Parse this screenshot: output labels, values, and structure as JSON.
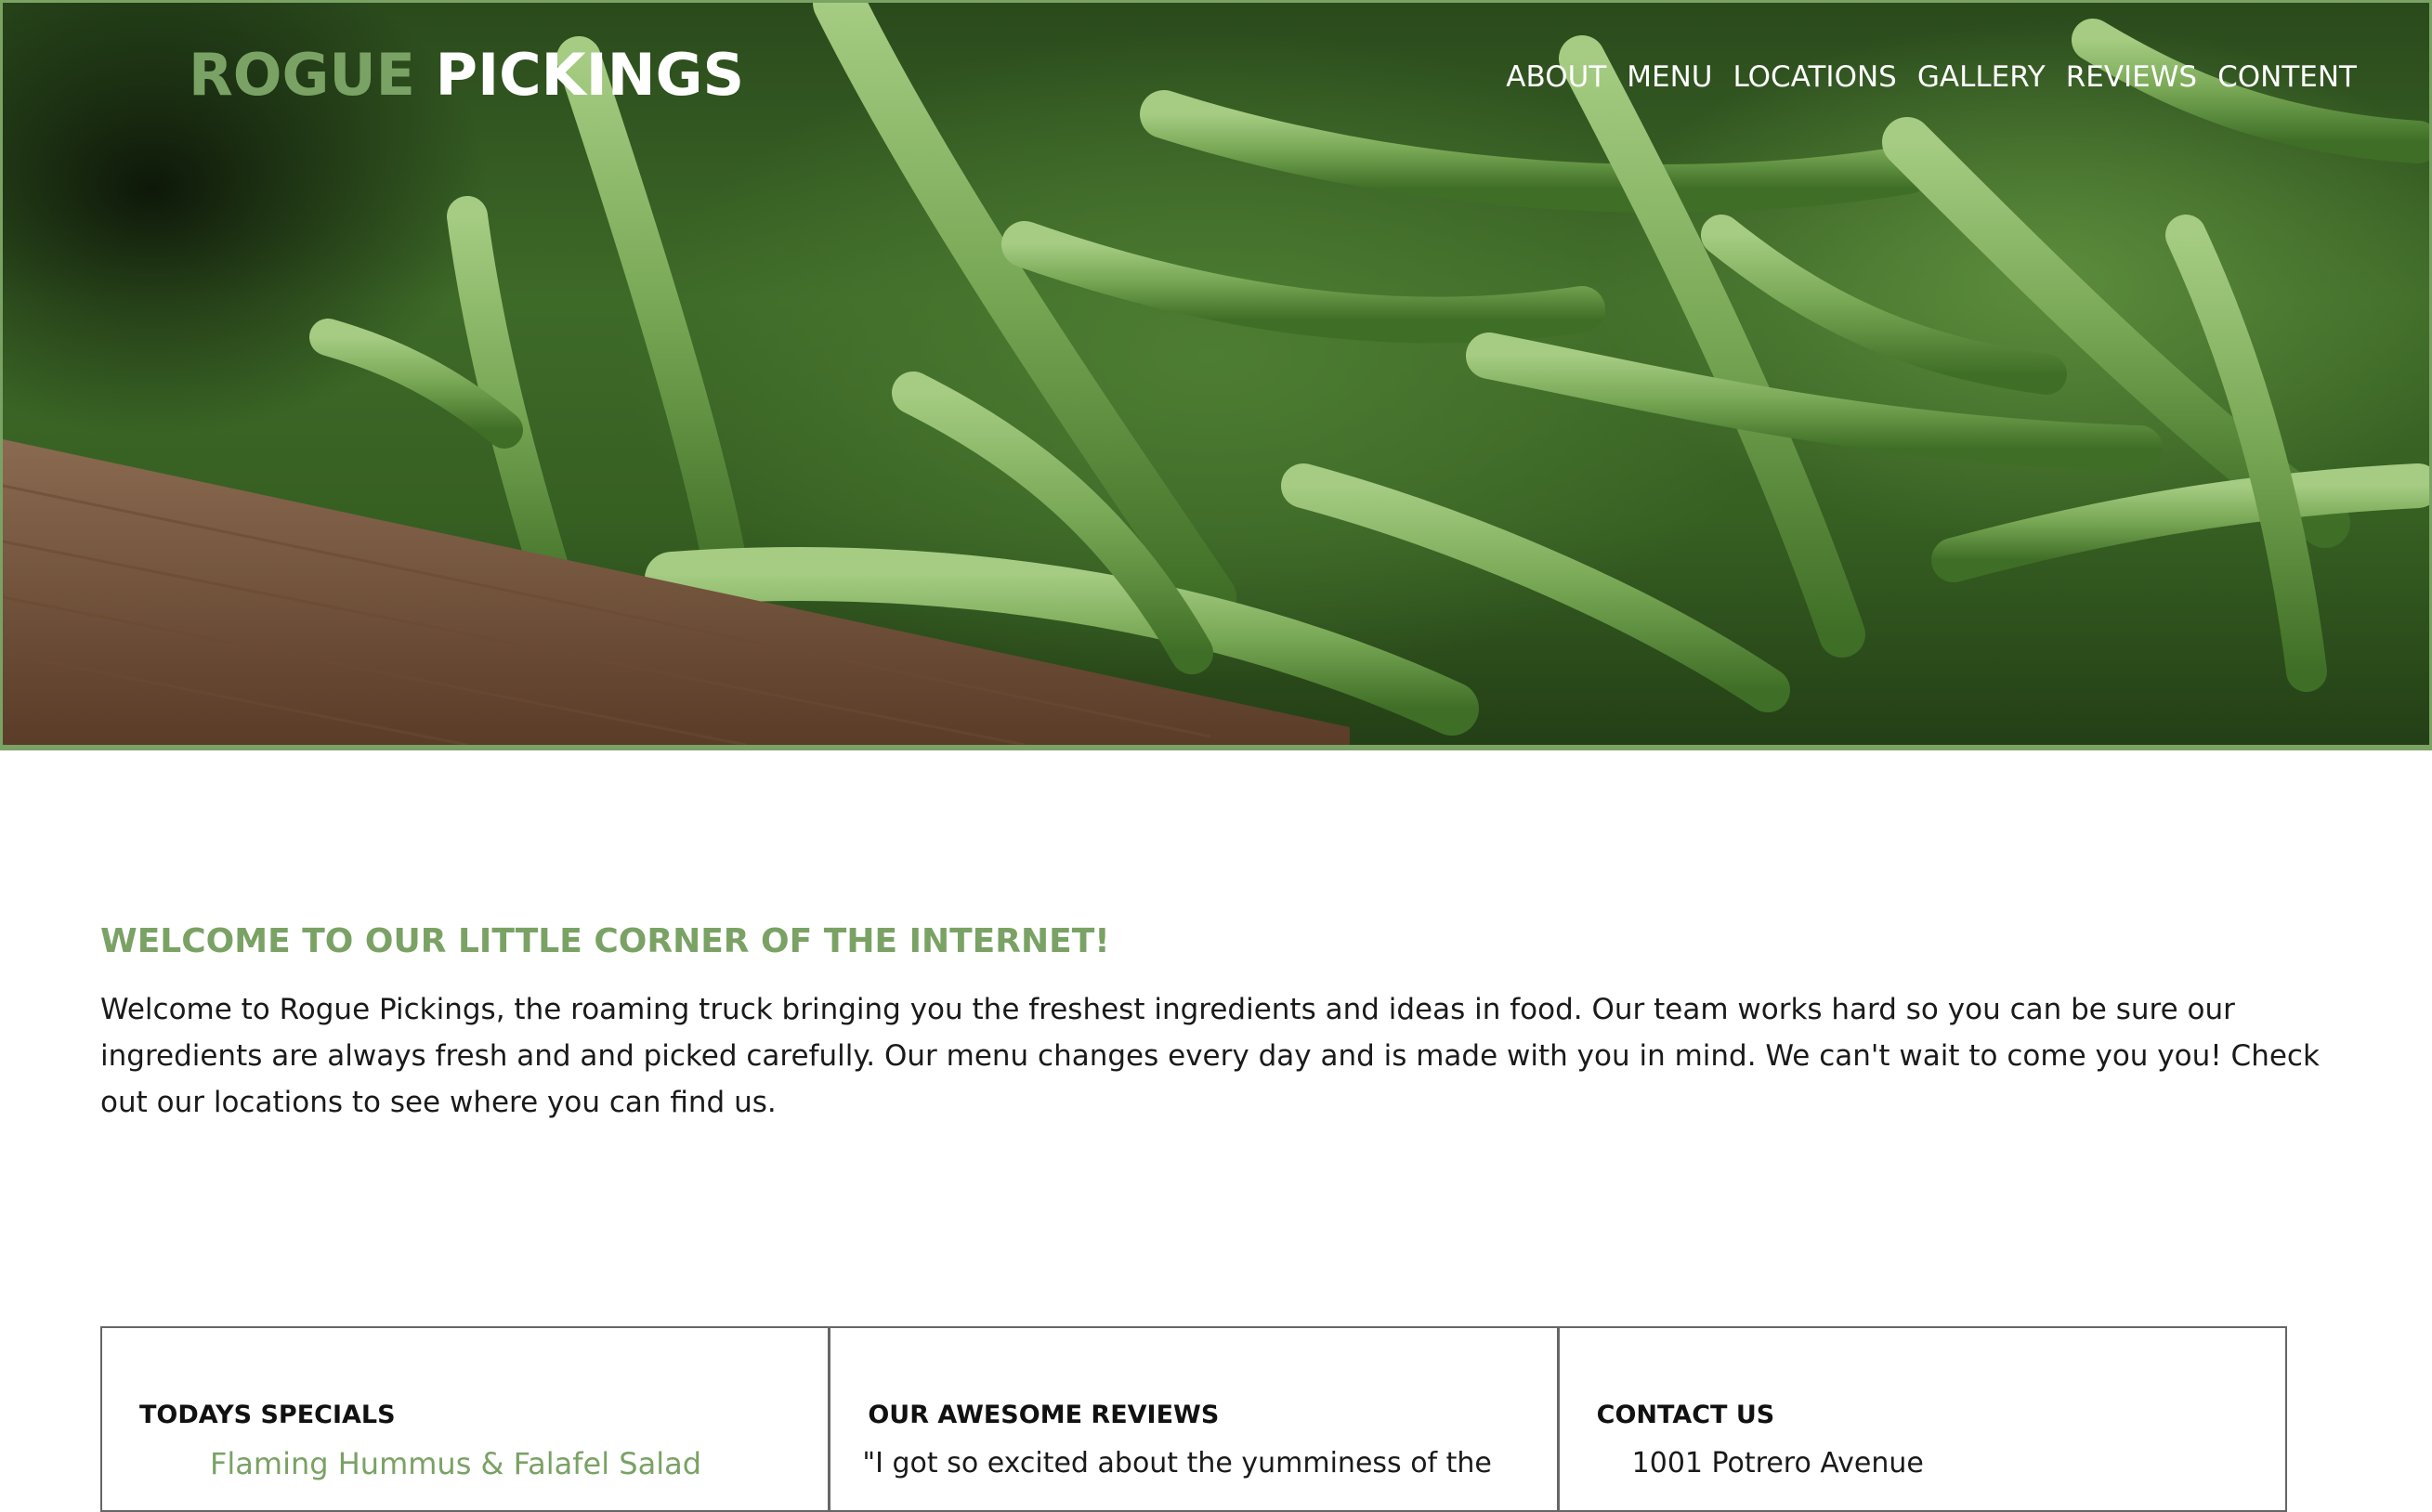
{
  "hero": {
    "image_alt": "green beans",
    "logo_part1": "ROGUE",
    "logo_part2": "PICKINGS"
  },
  "nav": {
    "items": [
      "ABOUT",
      "MENU",
      "LOCATIONS",
      "GALLERY",
      "REVIEWS",
      "CONTENT"
    ]
  },
  "welcome": {
    "heading": "WELCOME TO OUR LITTLE CORNER OF THE INTERNET!",
    "body": "Welcome to Rogue Pickings, the roaming truck bringing you the freshest ingredients and ideas in food. Our team works hard so you can be sure our ingredients are always fresh and and picked carefully. Our menu changes every day and is made with you in mind. We can't wait to come you you! Check out our locations to see where you can find us."
  },
  "specials": {
    "title": "TODAYS SPECIALS",
    "items": [
      "Flaming Hummus & Falafel Salad"
    ]
  },
  "reviews": {
    "title": "OUR AWESOME REVIEWS",
    "quote": "\"I got so excited about the yumminess of the"
  },
  "contact": {
    "title": "CONTACT US",
    "address": "1001 Potrero Avenue"
  },
  "colors": {
    "accent": "#7aa264",
    "text": "#1a1a1a",
    "border": "#666666"
  }
}
